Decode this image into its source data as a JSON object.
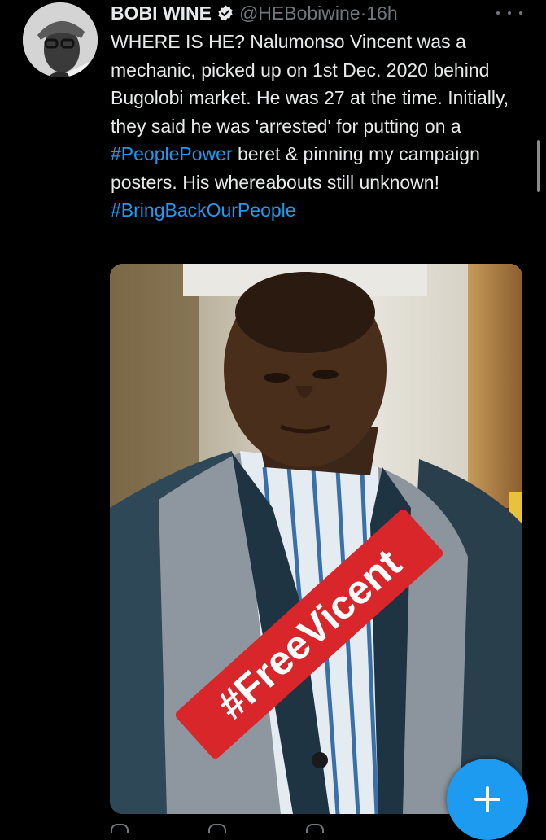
{
  "tweet": {
    "author_name": "BOBI WINE",
    "handle": "@HEBobiwine",
    "separator": "·",
    "time": "16h",
    "text_segments": [
      {
        "text": "WHERE IS HE? Nalumonso Vincent was a mechanic, picked up on 1st Dec. 2020 behind Bugolobi market. He was 27 at the time. Initially, they said he was 'arrested' for putting on a ",
        "type": "plain"
      },
      {
        "text": "#PeoplePower",
        "type": "hashtag"
      },
      {
        "text": " beret & pinning my campaign posters. His whereabouts still unknown! ",
        "type": "plain"
      },
      {
        "text": "#BringBackOurPeople",
        "type": "hashtag"
      }
    ],
    "image_overlay_text": "#FreeVicent"
  },
  "icons": {
    "verified": "verified-badge-icon",
    "more": "more-options-icon",
    "compose": "plus-icon",
    "reply": "reply-icon",
    "retweet": "retweet-icon",
    "like": "like-icon"
  },
  "colors": {
    "background": "#000000",
    "text": "#e7e9ea",
    "muted": "#71767b",
    "accent": "#1d9bf0",
    "banner": "#d9262b"
  }
}
